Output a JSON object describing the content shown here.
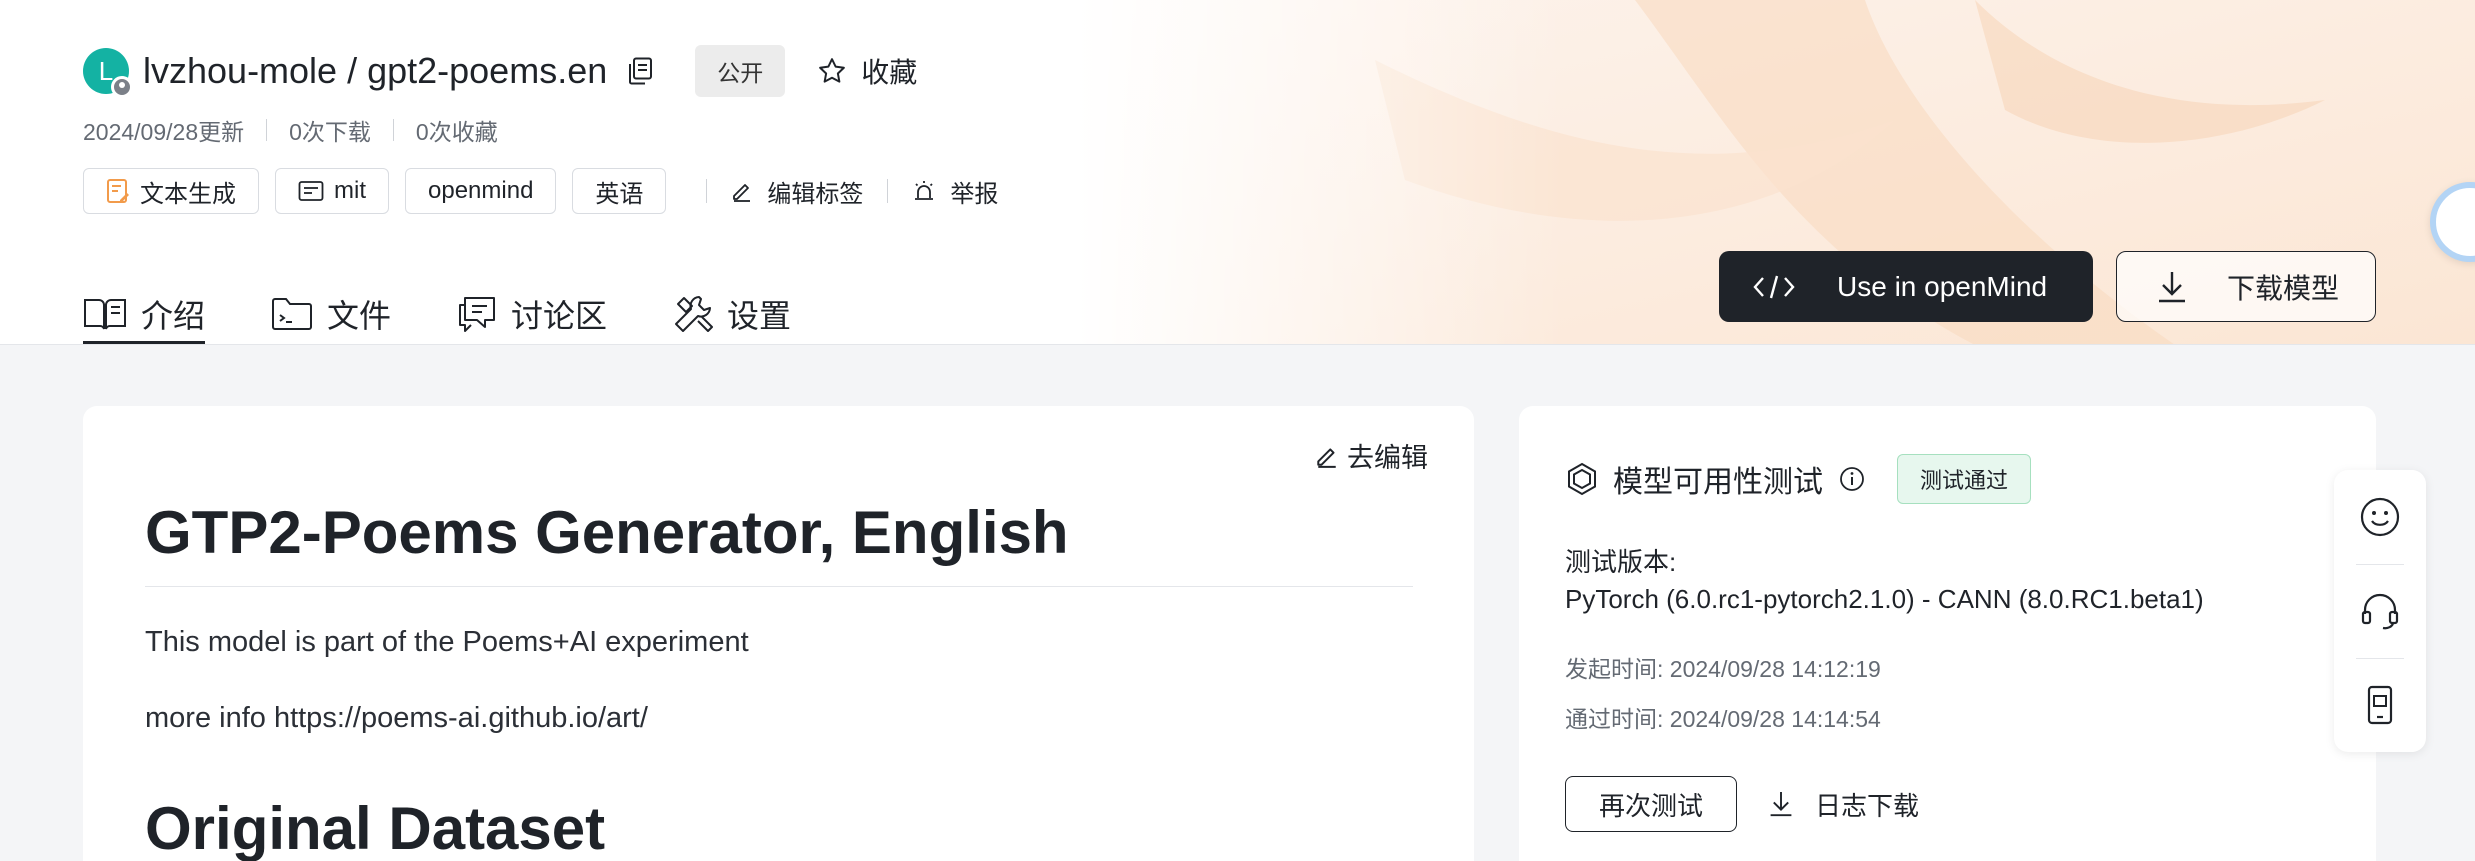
{
  "repo": {
    "avatar_letter": "L",
    "name": "lvzhou-mole / gpt2-poems.en",
    "visibility": "公开",
    "favorite_label": "收藏"
  },
  "meta": {
    "updated": "2024/09/28更新",
    "downloads": "0次下载",
    "favorites": "0次收藏"
  },
  "tags": {
    "task": "文本生成",
    "license": "mit",
    "framework": "openmind",
    "language": "英语",
    "edit_tags": "编辑标签",
    "report": "举报"
  },
  "tabs": {
    "intro": "介绍",
    "files": "文件",
    "discussion": "讨论区",
    "settings": "设置"
  },
  "actions": {
    "use_openmind": "Use in openMind",
    "download_model": "下载模型"
  },
  "readme": {
    "edit": "去编辑",
    "h1": "GTP2-Poems Generator, English",
    "p1": "This model is part of the Poems+AI experiment",
    "p2": "more info https://poems-ai.github.io/art/",
    "h2": "Original Dataset"
  },
  "test": {
    "title": "模型可用性测试",
    "status": "测试通过",
    "version_label": "测试版本:",
    "version_value": "PyTorch (6.0.rc1-pytorch2.1.0) - CANN (8.0.RC1.beta1)",
    "start_time": "发起时间:  2024/09/28 14:12:19",
    "pass_time": "通过时间:  2024/09/28 14:14:54",
    "retest": "再次测试",
    "log_download": "日志下载"
  },
  "colors": {
    "accent_dark": "#1f2329",
    "avatar": "#14b2a3",
    "pass_bg": "#e7f7ee",
    "pass_border": "#a6e0bf"
  },
  "icons": [
    "copy-icon",
    "star-icon",
    "text-generation-icon",
    "license-icon",
    "edit-icon",
    "report-icon",
    "book-icon",
    "folder-icon",
    "chat-icon",
    "tools-icon",
    "code-icon",
    "download-icon",
    "hexagon-icon",
    "info-icon",
    "smile-icon",
    "headset-icon",
    "phone-icon"
  ]
}
